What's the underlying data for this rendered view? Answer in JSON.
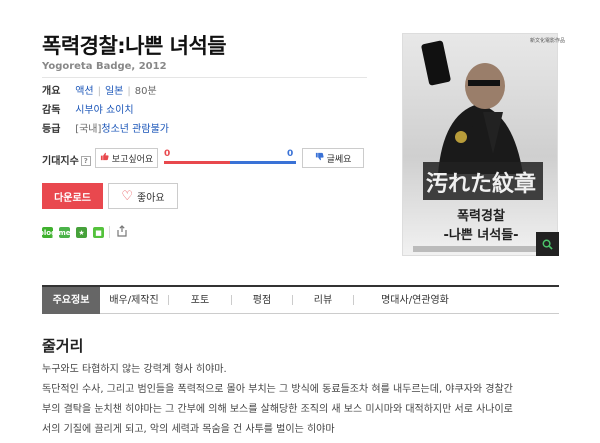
{
  "movie": {
    "title": "폭력경찰:나쁜 녀석들",
    "subtitle": "Yogoreta Badge, 2012"
  },
  "info": {
    "overview_label": "개요",
    "genre": "액션",
    "country": "일본",
    "runtime": "80분",
    "director_label": "감독",
    "director": "시부야 쇼이치",
    "rating_label": "등급",
    "rating_prefix": "[국내]",
    "rating": "청소년 관람불가"
  },
  "rating_index": {
    "label": "기대지수",
    "help": "?",
    "want_label": "보고싶어요",
    "want_count": "0",
    "meh_label": "글쎄요",
    "meh_count": "0",
    "want_share": 0.5,
    "colors": {
      "want": "#e8484d",
      "meh": "#3a72d6"
    }
  },
  "actions": {
    "download_label": "다운로드",
    "like_label": "좋아요"
  },
  "share": {
    "icons": [
      {
        "name": "blog-icon",
        "label": "blog",
        "color": "#3fb12e"
      },
      {
        "name": "talk-icon",
        "label": "me",
        "color": "#4bb34a"
      },
      {
        "name": "star-icon",
        "label": "★",
        "color": "#46a13a"
      },
      {
        "name": "square-icon",
        "label": "■",
        "color": "#54c23c"
      }
    ]
  },
  "poster": {
    "top_text": "新文化電影作品",
    "jp_title": "汚れた紋章",
    "kr_title_1": "폭력경찰",
    "kr_title_2": "-나쁜 녀석들-"
  },
  "tabs": [
    {
      "label": "주요정보",
      "active": true
    },
    {
      "label": "배우/제작진",
      "active": false
    },
    {
      "label": "포토",
      "active": false
    },
    {
      "label": "평점",
      "active": false
    },
    {
      "label": "리뷰",
      "active": false
    },
    {
      "label": "명대사/연관영화",
      "active": false
    }
  ],
  "synopsis": {
    "heading": "줄거리",
    "lines": [
      "누구와도 타협하지 않는 강력계 형사 히야마.",
      "  독단적인 수사, 그리고 범인들을 폭력적으로 몰아 부치는 그 방식에 동료들조차 혀를 내두르는데, 야쿠자와 경찰간",
      "부의 결탁을 눈치챈 히야마는 그 간부에 의해 보스를 살해당한 조직의 새 보스 미시마와 대적하지만 서로 사나이로",
      "서의 기질에 끌리게 되고, 악의 세력과 목숨을 건 사투를 벌이는 히야마"
    ]
  }
}
